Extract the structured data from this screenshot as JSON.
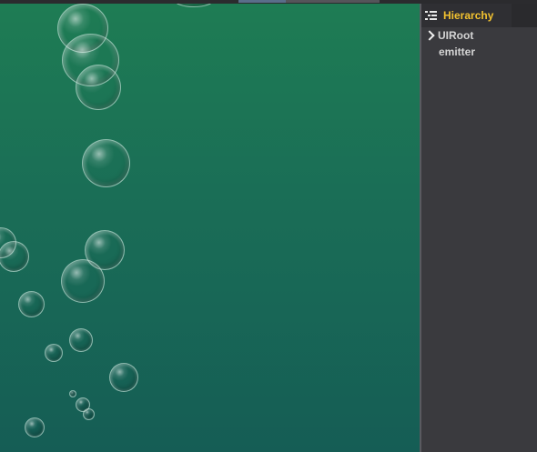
{
  "hierarchy_panel": {
    "title": "Hierarchy",
    "icon": "list-tree-icon",
    "title_color": "#f2c230",
    "items": [
      {
        "label": "UIRoot",
        "expandable": true
      },
      {
        "label": "emitter",
        "expandable": false
      }
    ]
  },
  "scene_view": {
    "background_top_color": "#1e7c54",
    "background_bottom_color": "#155d55"
  }
}
